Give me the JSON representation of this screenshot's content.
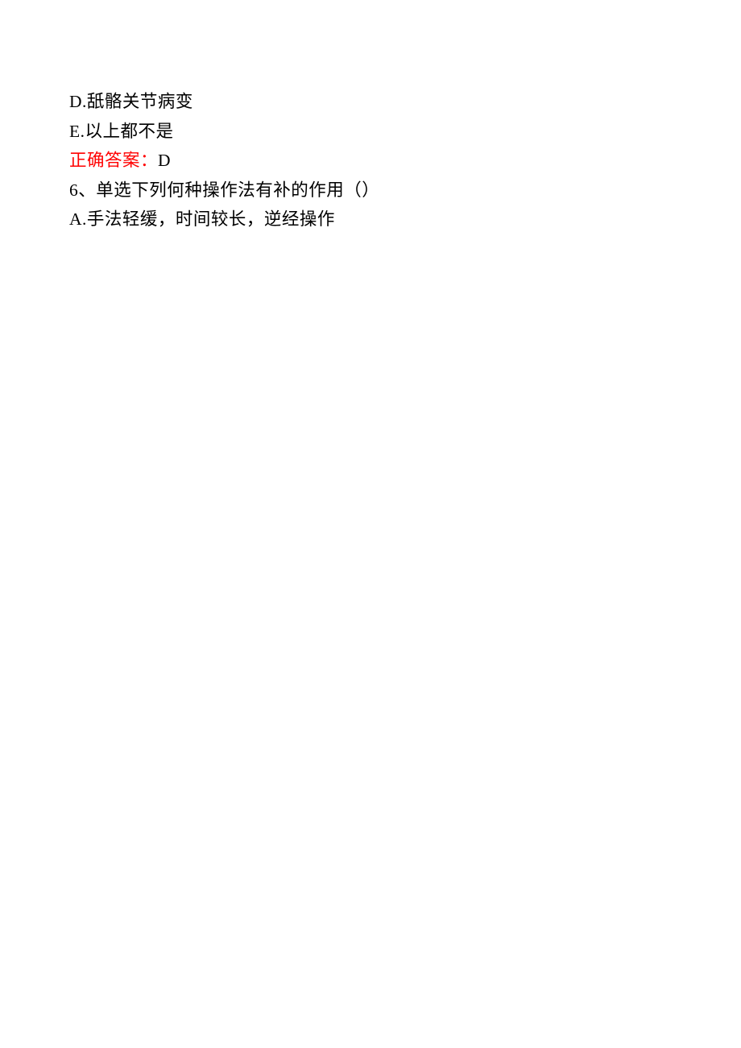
{
  "lines": {
    "optD": "D.舐骼关节病变",
    "optE": "E.以上都不是",
    "answerLabel": "正确答案：",
    "answerValue": "D",
    "q6": "6、单选下列何种操作法有补的作用（）",
    "q6optA": "A.手法轻缓，时间较长，逆经操作"
  }
}
